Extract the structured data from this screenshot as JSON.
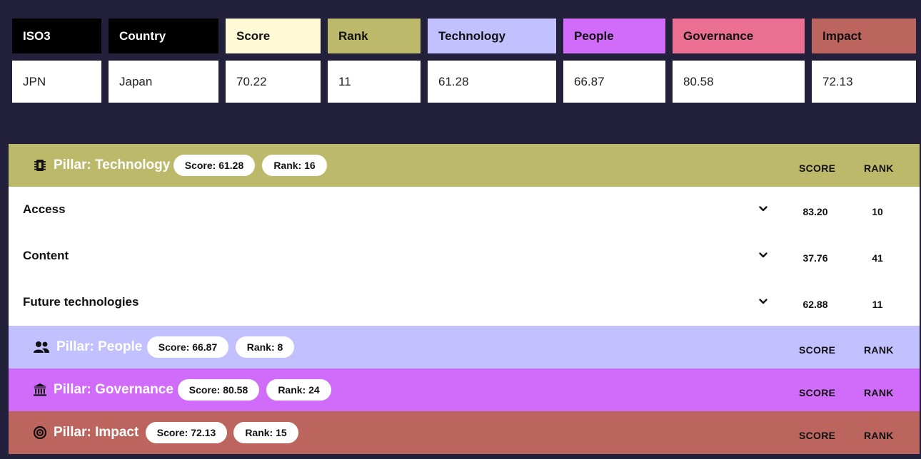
{
  "colors": {
    "background": "#22203a",
    "technology": "#bdb96a",
    "people": "#c2c0ff",
    "governance": "#d06bfa",
    "impact": "#bb655e",
    "score_header": "#fdfad5",
    "rank_header": "#bdb96a",
    "governance_header": "#ea6f93",
    "black": "#000000"
  },
  "summary": {
    "headers": [
      "ISO3",
      "Country",
      "Score",
      "Rank",
      "Technology",
      "People",
      "Governance",
      "Impact"
    ],
    "values": [
      "JPN",
      "Japan",
      "70.22",
      "11",
      "61.28",
      "66.87",
      "80.58",
      "72.13"
    ]
  },
  "pillars": [
    {
      "title": "Pillar: Technology",
      "score": "Score: 61.28",
      "rank": "Rank: 16",
      "icon": "chip-icon",
      "score_col": "SCORE",
      "rank_col": "RANK",
      "subs": [
        {
          "label": "Access",
          "score": "83.20",
          "rank": "10"
        },
        {
          "label": "Content",
          "score": "37.76",
          "rank": "41"
        },
        {
          "label": "Future technologies",
          "score": "62.88",
          "rank": "11"
        }
      ]
    },
    {
      "title": "Pillar: People",
      "score": "Score: 66.87",
      "rank": "Rank: 8",
      "icon": "people-icon",
      "score_col": "SCORE",
      "rank_col": "RANK"
    },
    {
      "title": "Pillar: Governance",
      "score": "Score: 80.58",
      "rank": "Rank: 24",
      "icon": "bank-icon",
      "score_col": "SCORE",
      "rank_col": "RANK"
    },
    {
      "title": "Pillar: Impact",
      "score": "Score: 72.13",
      "rank": "Rank: 15",
      "icon": "target-icon",
      "score_col": "SCORE",
      "rank_col": "RANK"
    }
  ]
}
